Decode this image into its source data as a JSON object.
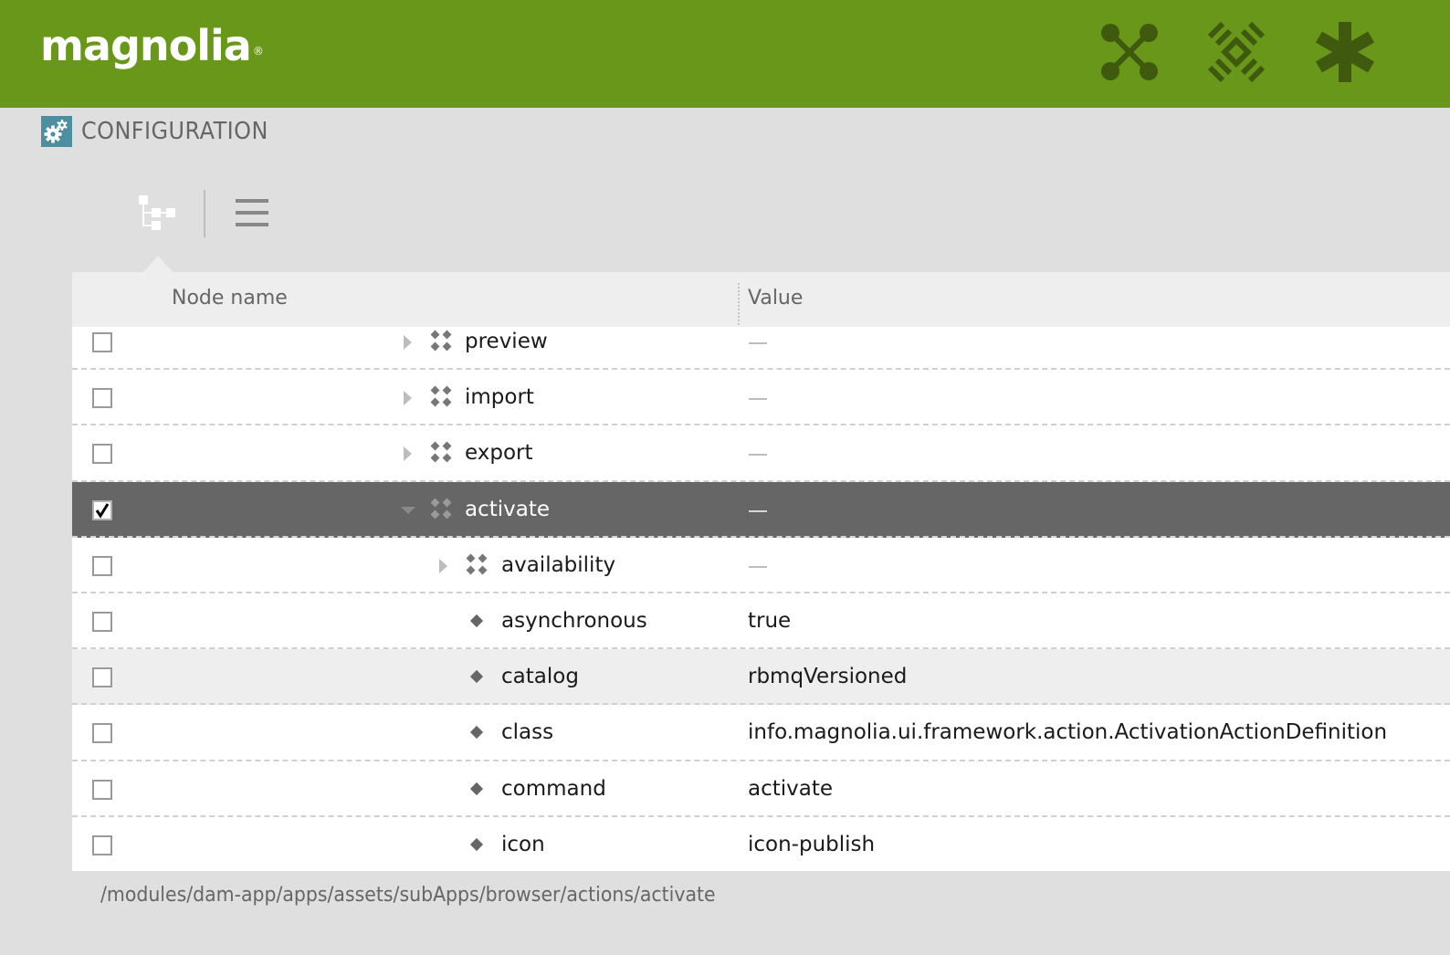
{
  "brand": {
    "logo_text": "magnolia",
    "registered_mark": "®",
    "bar_color": "#689719",
    "icon_color": "#3f5a0e"
  },
  "top_nav": [
    {
      "name": "apps-icon",
      "label": "Apps"
    },
    {
      "name": "pulse-icon",
      "label": "Pulse"
    },
    {
      "name": "favorites-icon",
      "label": "Favorites"
    }
  ],
  "app": {
    "title": "CONFIGURATION",
    "icon": "gears-icon",
    "icon_color": "#4d8fa0"
  },
  "view_switcher": {
    "active": "tree-view",
    "options": [
      {
        "name": "tree-view-icon",
        "label": "Tree view"
      },
      {
        "name": "list-view-icon",
        "label": "List view"
      }
    ]
  },
  "grid": {
    "columns": {
      "node_name": "Node name",
      "value": "Value"
    },
    "rows": [
      {
        "name": "preview",
        "type": "node",
        "level": 1,
        "expanded": false,
        "value": "",
        "checked": false,
        "selected": false,
        "alt": false
      },
      {
        "name": "import",
        "type": "node",
        "level": 1,
        "expanded": false,
        "value": "",
        "checked": false,
        "selected": false,
        "alt": false
      },
      {
        "name": "export",
        "type": "node",
        "level": 1,
        "expanded": false,
        "value": "",
        "checked": false,
        "selected": false,
        "alt": false
      },
      {
        "name": "activate",
        "type": "node",
        "level": 1,
        "expanded": true,
        "value": "",
        "checked": true,
        "selected": true,
        "alt": false
      },
      {
        "name": "availability",
        "type": "node",
        "level": 2,
        "expanded": false,
        "value": "",
        "checked": false,
        "selected": false,
        "alt": false
      },
      {
        "name": "asynchronous",
        "type": "property",
        "level": 2,
        "value": "true",
        "checked": false,
        "selected": false,
        "alt": false
      },
      {
        "name": "catalog",
        "type": "property",
        "level": 2,
        "value": "rbmqVersioned",
        "checked": false,
        "selected": false,
        "alt": true
      },
      {
        "name": "class",
        "type": "property",
        "level": 2,
        "value": "info.magnolia.ui.framework.action.ActivationActionDefinition",
        "checked": false,
        "selected": false,
        "alt": false
      },
      {
        "name": "command",
        "type": "property",
        "level": 2,
        "value": "activate",
        "checked": false,
        "selected": false,
        "alt": false
      },
      {
        "name": "icon",
        "type": "property",
        "level": 2,
        "value": "icon-publish",
        "checked": false,
        "selected": false,
        "alt": false
      }
    ]
  },
  "status_bar": {
    "path": "/modules/dam-app/apps/assets/subApps/browser/actions/activate"
  }
}
